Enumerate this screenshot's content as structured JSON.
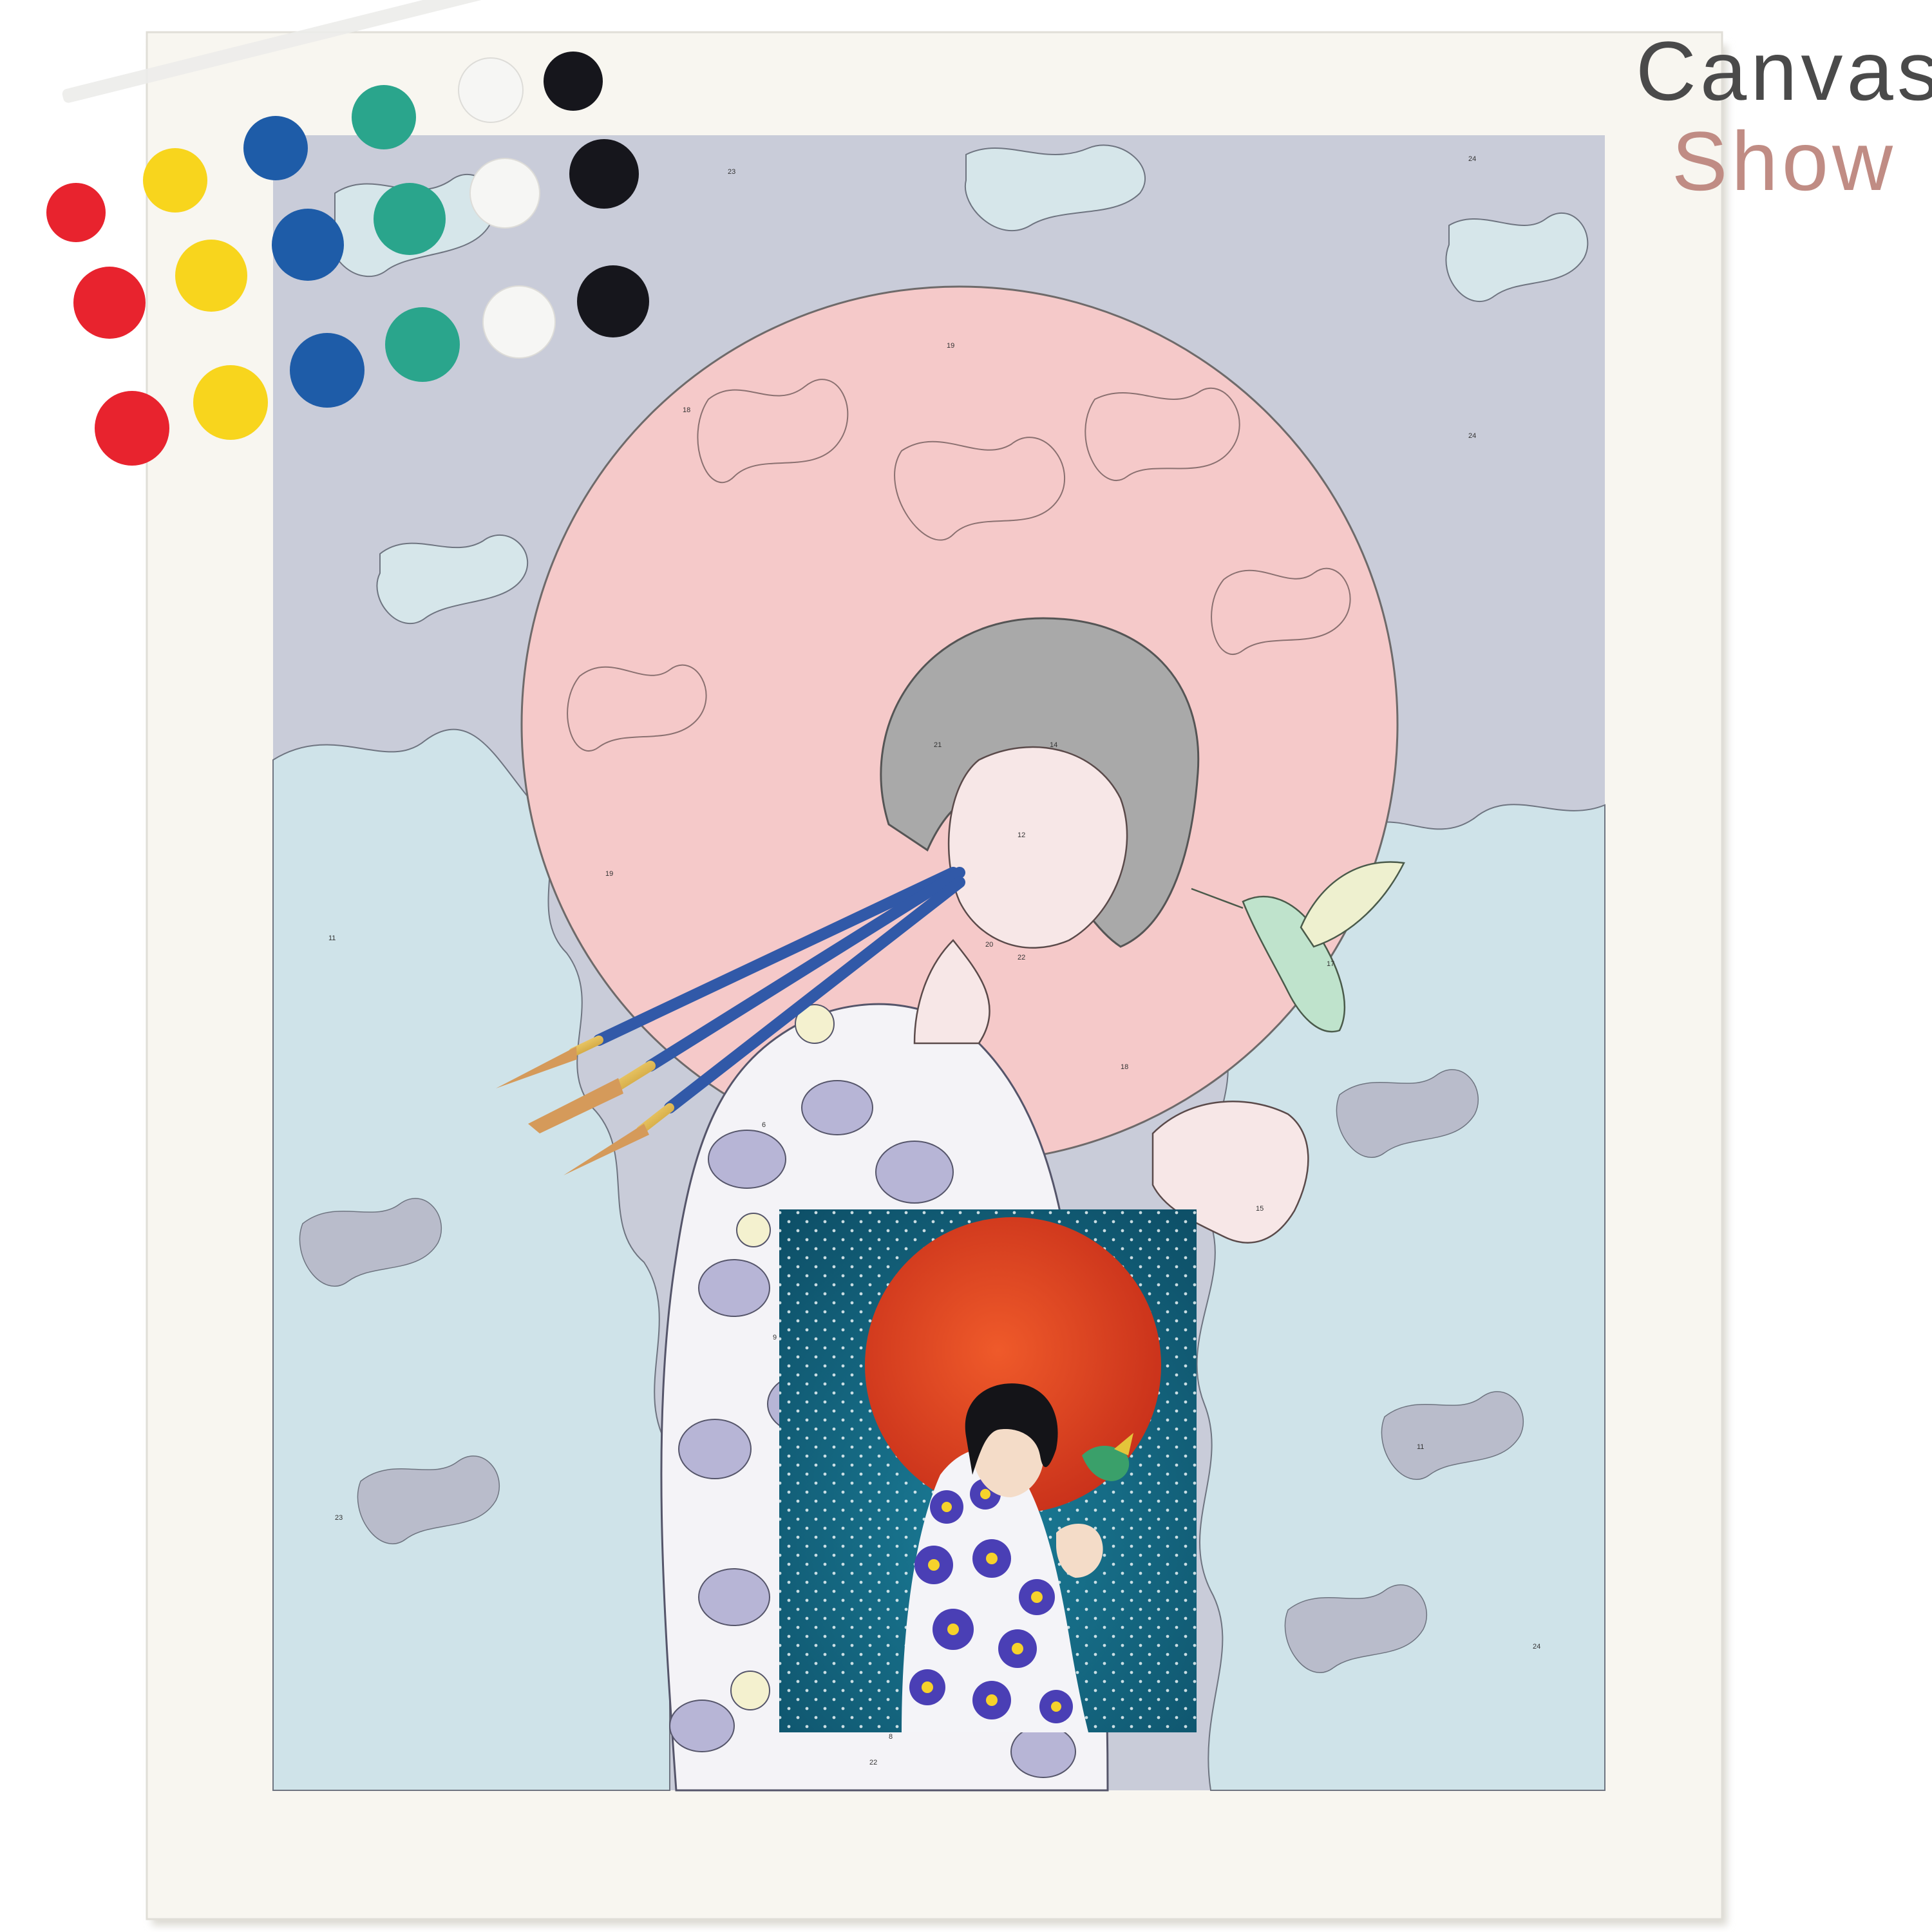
{
  "brand": {
    "line1": "Canvas",
    "line2": "Show"
  },
  "colors": {
    "page_background": "#ffffff",
    "canvas_board": "#f8f6f0",
    "template_sky": "#c9ccd9",
    "template_cloud": "#cfe3e9",
    "template_moon": "#f5c9c9",
    "preview_background": "#136781",
    "preview_moon": "#e0431e",
    "brand_dark": "#4a4a4a",
    "brand_accent": "#c08c84"
  },
  "paint_pots": [
    {
      "color_name": "red",
      "hex": "#e8232e"
    },
    {
      "color_name": "yellow",
      "hex": "#f8d51d"
    },
    {
      "color_name": "blue",
      "hex": "#1e5ca8"
    },
    {
      "color_name": "teal",
      "hex": "#2aa58c"
    },
    {
      "color_name": "white",
      "hex": "#f6f6f4"
    },
    {
      "color_name": "black",
      "hex": "#16161c"
    }
  ],
  "brushes": [
    {
      "handle_color": "#3159a8",
      "tip": "round"
    },
    {
      "handle_color": "#3159a8",
      "tip": "flat"
    },
    {
      "handle_color": "#3159a8",
      "tip": "round"
    }
  ],
  "template_numbers": [
    "23",
    "24",
    "18",
    "19",
    "21",
    "14",
    "12",
    "22",
    "9",
    "11",
    "15",
    "20",
    "6",
    "17",
    "8"
  ]
}
